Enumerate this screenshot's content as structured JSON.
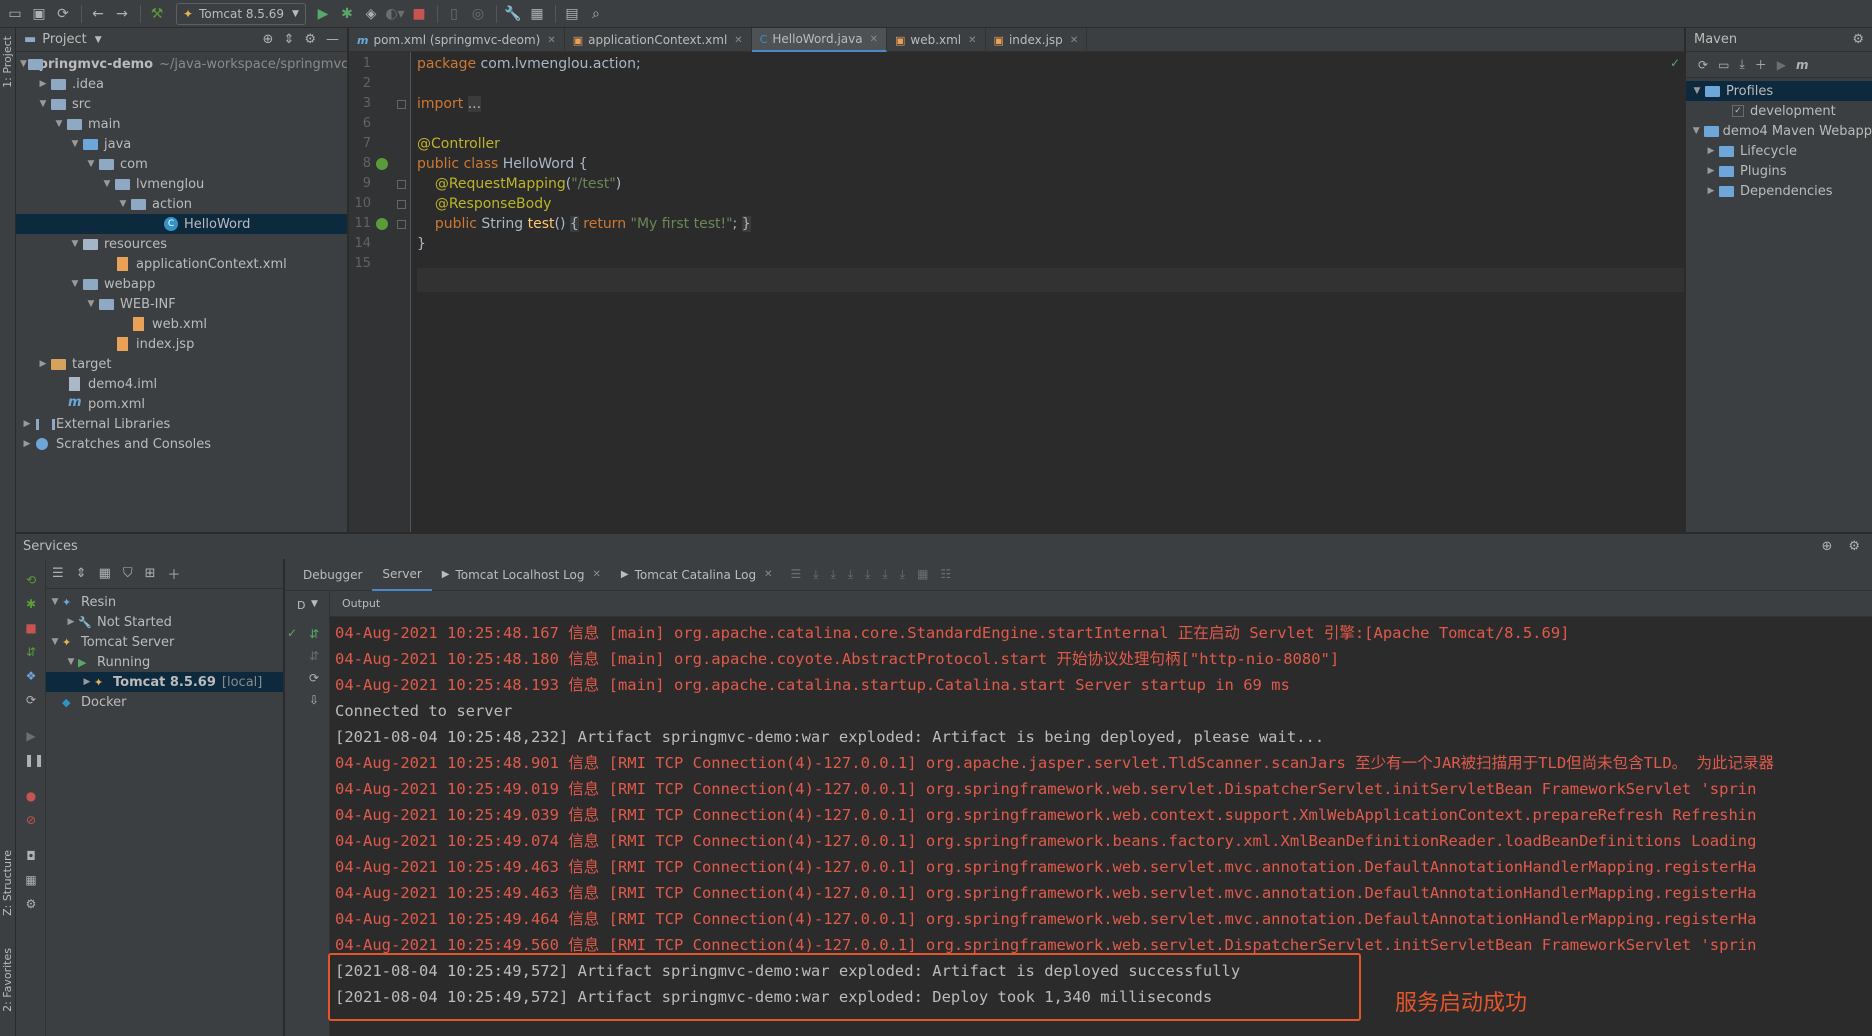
{
  "toolbar": {
    "run_config": "Tomcat 8.5.69"
  },
  "left_stripe": {
    "project_tab": "1: Project",
    "structure_tab": "Z: Structure",
    "favorites_tab": "2: Favorites"
  },
  "project": {
    "title": "Project",
    "tree": [
      {
        "label": "springmvc-demo",
        "hint": "~/java-workspace/springmvc",
        "icon": "folder",
        "indent": 0,
        "arrow": "down",
        "bold": true
      },
      {
        "label": ".idea",
        "icon": "folder",
        "indent": 1,
        "arrow": "right"
      },
      {
        "label": "src",
        "icon": "folder",
        "indent": 1,
        "arrow": "down"
      },
      {
        "label": "main",
        "icon": "folder",
        "indent": 2,
        "arrow": "down"
      },
      {
        "label": "java",
        "icon": "folder-blue",
        "indent": 3,
        "arrow": "down"
      },
      {
        "label": "com",
        "icon": "folder",
        "indent": 4,
        "arrow": "down"
      },
      {
        "label": "lvmenglou",
        "icon": "folder",
        "indent": 5,
        "arrow": "down"
      },
      {
        "label": "action",
        "icon": "folder",
        "indent": 6,
        "arrow": "down"
      },
      {
        "label": "HelloWord",
        "icon": "class",
        "indent": 8,
        "arrow": "",
        "selected": true
      },
      {
        "label": "resources",
        "icon": "folder-res",
        "indent": 3,
        "arrow": "down"
      },
      {
        "label": "applicationContext.xml",
        "icon": "xml",
        "indent": 5,
        "arrow": ""
      },
      {
        "label": "webapp",
        "icon": "folder",
        "indent": 3,
        "arrow": "down"
      },
      {
        "label": "WEB-INF",
        "icon": "folder",
        "indent": 4,
        "arrow": "down"
      },
      {
        "label": "web.xml",
        "icon": "xml",
        "indent": 6,
        "arrow": ""
      },
      {
        "label": "index.jsp",
        "icon": "xml",
        "indent": 5,
        "arrow": ""
      },
      {
        "label": "target",
        "icon": "folder-orange",
        "indent": 1,
        "arrow": "right"
      },
      {
        "label": "demo4.iml",
        "icon": "file",
        "indent": 2,
        "arrow": ""
      },
      {
        "label": "pom.xml",
        "icon": "mvn",
        "indent": 2,
        "arrow": ""
      },
      {
        "label": "External Libraries",
        "icon": "lib",
        "indent": 0,
        "arrow": "right"
      },
      {
        "label": "Scratches and Consoles",
        "icon": "scratch",
        "indent": 0,
        "arrow": "right"
      }
    ]
  },
  "editor": {
    "tabs": [
      {
        "label": "pom.xml (springmvc-deom)",
        "icon": "m",
        "active": false
      },
      {
        "label": "applicationContext.xml",
        "icon": "x",
        "active": false
      },
      {
        "label": "HelloWord.java",
        "icon": "C",
        "active": true
      },
      {
        "label": "web.xml",
        "icon": "x",
        "active": false
      },
      {
        "label": "index.jsp",
        "icon": "x",
        "active": false
      }
    ],
    "line_numbers": [
      "1",
      "2",
      "3",
      "6",
      "7",
      "8",
      "9",
      "10",
      "11",
      "14",
      "15"
    ],
    "code": {
      "l1_kw": "package",
      "l1_rest": " com.lvmenglou.action;",
      "l3_kw": "import",
      "l3_fold": "...",
      "l7_ann": "@Controller",
      "l8_kw": "public class",
      "l8_rest": " HelloWord {",
      "l9_ann": "@RequestMapping",
      "l9_p1": "(",
      "l9_str": "\"/test\"",
      "l9_p2": ")",
      "l10_ann": "@ResponseBody",
      "l11_kw": "public",
      "l11_type": " String ",
      "l11_fn": "test",
      "l11_p": "() ",
      "l11_b1": "{",
      "l11_kw2": " return ",
      "l11_str": "\"My first test!\"",
      "l11_semi": "; ",
      "l11_b2": "}",
      "l14": "}"
    }
  },
  "maven": {
    "title": "Maven",
    "tree": [
      {
        "label": "Profiles",
        "indent": 0,
        "arrow": "down",
        "selected": true
      },
      {
        "label": "development",
        "indent": 2,
        "arrow": "",
        "check": true
      },
      {
        "label": "demo4 Maven Webapp",
        "indent": 0,
        "arrow": "down"
      },
      {
        "label": "Lifecycle",
        "indent": 1,
        "arrow": "right"
      },
      {
        "label": "Plugins",
        "indent": 1,
        "arrow": "right"
      },
      {
        "label": "Dependencies",
        "indent": 1,
        "arrow": "right"
      }
    ]
  },
  "services": {
    "title": "Services",
    "tree": [
      {
        "label": "Resin",
        "indent": 0,
        "arrow": "down"
      },
      {
        "label": "Not Started",
        "indent": 1,
        "arrow": "right"
      },
      {
        "label": "Tomcat Server",
        "indent": 0,
        "arrow": "down"
      },
      {
        "label": "Running",
        "indent": 1,
        "arrow": "down"
      },
      {
        "label": "Tomcat 8.5.69",
        "suffix": "[local]",
        "indent": 2,
        "arrow": "right",
        "selected": true,
        "bold": true
      },
      {
        "label": "Docker",
        "indent": 0,
        "arrow": ""
      }
    ],
    "tabs": [
      {
        "label": "Debugger",
        "active": false,
        "closable": false
      },
      {
        "label": "Server",
        "active": true,
        "closable": false
      },
      {
        "label": "Tomcat Localhost Log",
        "active": false,
        "closable": true
      },
      {
        "label": "Tomcat Catalina Log",
        "active": false,
        "closable": true
      }
    ],
    "side_label": "D",
    "output_label": "Output",
    "log": [
      {
        "text": "04-Aug-2021 10:25:48.167 信息 [main] org.apache.catalina.core.StandardEngine.startInternal 正在启动 Servlet 引擎:[Apache Tomcat/8.5.69]",
        "type": "red"
      },
      {
        "text": "04-Aug-2021 10:25:48.180 信息 [main] org.apache.coyote.AbstractProtocol.start 开始协议处理句柄[\"http-nio-8080\"]",
        "type": "red"
      },
      {
        "text": "04-Aug-2021 10:25:48.193 信息 [main] org.apache.catalina.startup.Catalina.start Server startup in 69 ms",
        "type": "red"
      },
      {
        "text": "Connected to server",
        "type": "plain"
      },
      {
        "text": "[2021-08-04 10:25:48,232] Artifact springmvc-demo:war exploded: Artifact is being deployed, please wait...",
        "type": "plain"
      },
      {
        "text": "04-Aug-2021 10:25:48.901 信息 [RMI TCP Connection(4)-127.0.0.1] org.apache.jasper.servlet.TldScanner.scanJars 至少有一个JAR被扫描用于TLD但尚未包含TLD。 为此记录器",
        "type": "red"
      },
      {
        "text": "04-Aug-2021 10:25:49.019 信息 [RMI TCP Connection(4)-127.0.0.1] org.springframework.web.servlet.DispatcherServlet.initServletBean FrameworkServlet 'sprin",
        "type": "red"
      },
      {
        "text": "04-Aug-2021 10:25:49.039 信息 [RMI TCP Connection(4)-127.0.0.1] org.springframework.web.context.support.XmlWebApplicationContext.prepareRefresh Refreshin",
        "type": "red"
      },
      {
        "text": "04-Aug-2021 10:25:49.074 信息 [RMI TCP Connection(4)-127.0.0.1] org.springframework.beans.factory.xml.XmlBeanDefinitionReader.loadBeanDefinitions Loading",
        "type": "red"
      },
      {
        "text": "04-Aug-2021 10:25:49.463 信息 [RMI TCP Connection(4)-127.0.0.1] org.springframework.web.servlet.mvc.annotation.DefaultAnnotationHandlerMapping.registerHa",
        "type": "red"
      },
      {
        "text": "04-Aug-2021 10:25:49.463 信息 [RMI TCP Connection(4)-127.0.0.1] org.springframework.web.servlet.mvc.annotation.DefaultAnnotationHandlerMapping.registerHa",
        "type": "red"
      },
      {
        "text": "04-Aug-2021 10:25:49.464 信息 [RMI TCP Connection(4)-127.0.0.1] org.springframework.web.servlet.mvc.annotation.DefaultAnnotationHandlerMapping.registerHa",
        "type": "red"
      },
      {
        "text": "04-Aug-2021 10:25:49.560 信息 [RMI TCP Connection(4)-127.0.0.1] org.springframework.web.servlet.DispatcherServlet.initServletBean FrameworkServlet 'sprin",
        "type": "red"
      },
      {
        "text": "[2021-08-04 10:25:49,572] Artifact springmvc-demo:war exploded: Artifact is deployed successfully",
        "type": "plain"
      },
      {
        "text": "[2021-08-04 10:25:49,572] Artifact springmvc-demo:war exploded: Deploy took 1,340 milliseconds",
        "type": "plain"
      }
    ]
  },
  "annotation": {
    "text": "服务启动成功",
    "color": "#e4562a"
  }
}
